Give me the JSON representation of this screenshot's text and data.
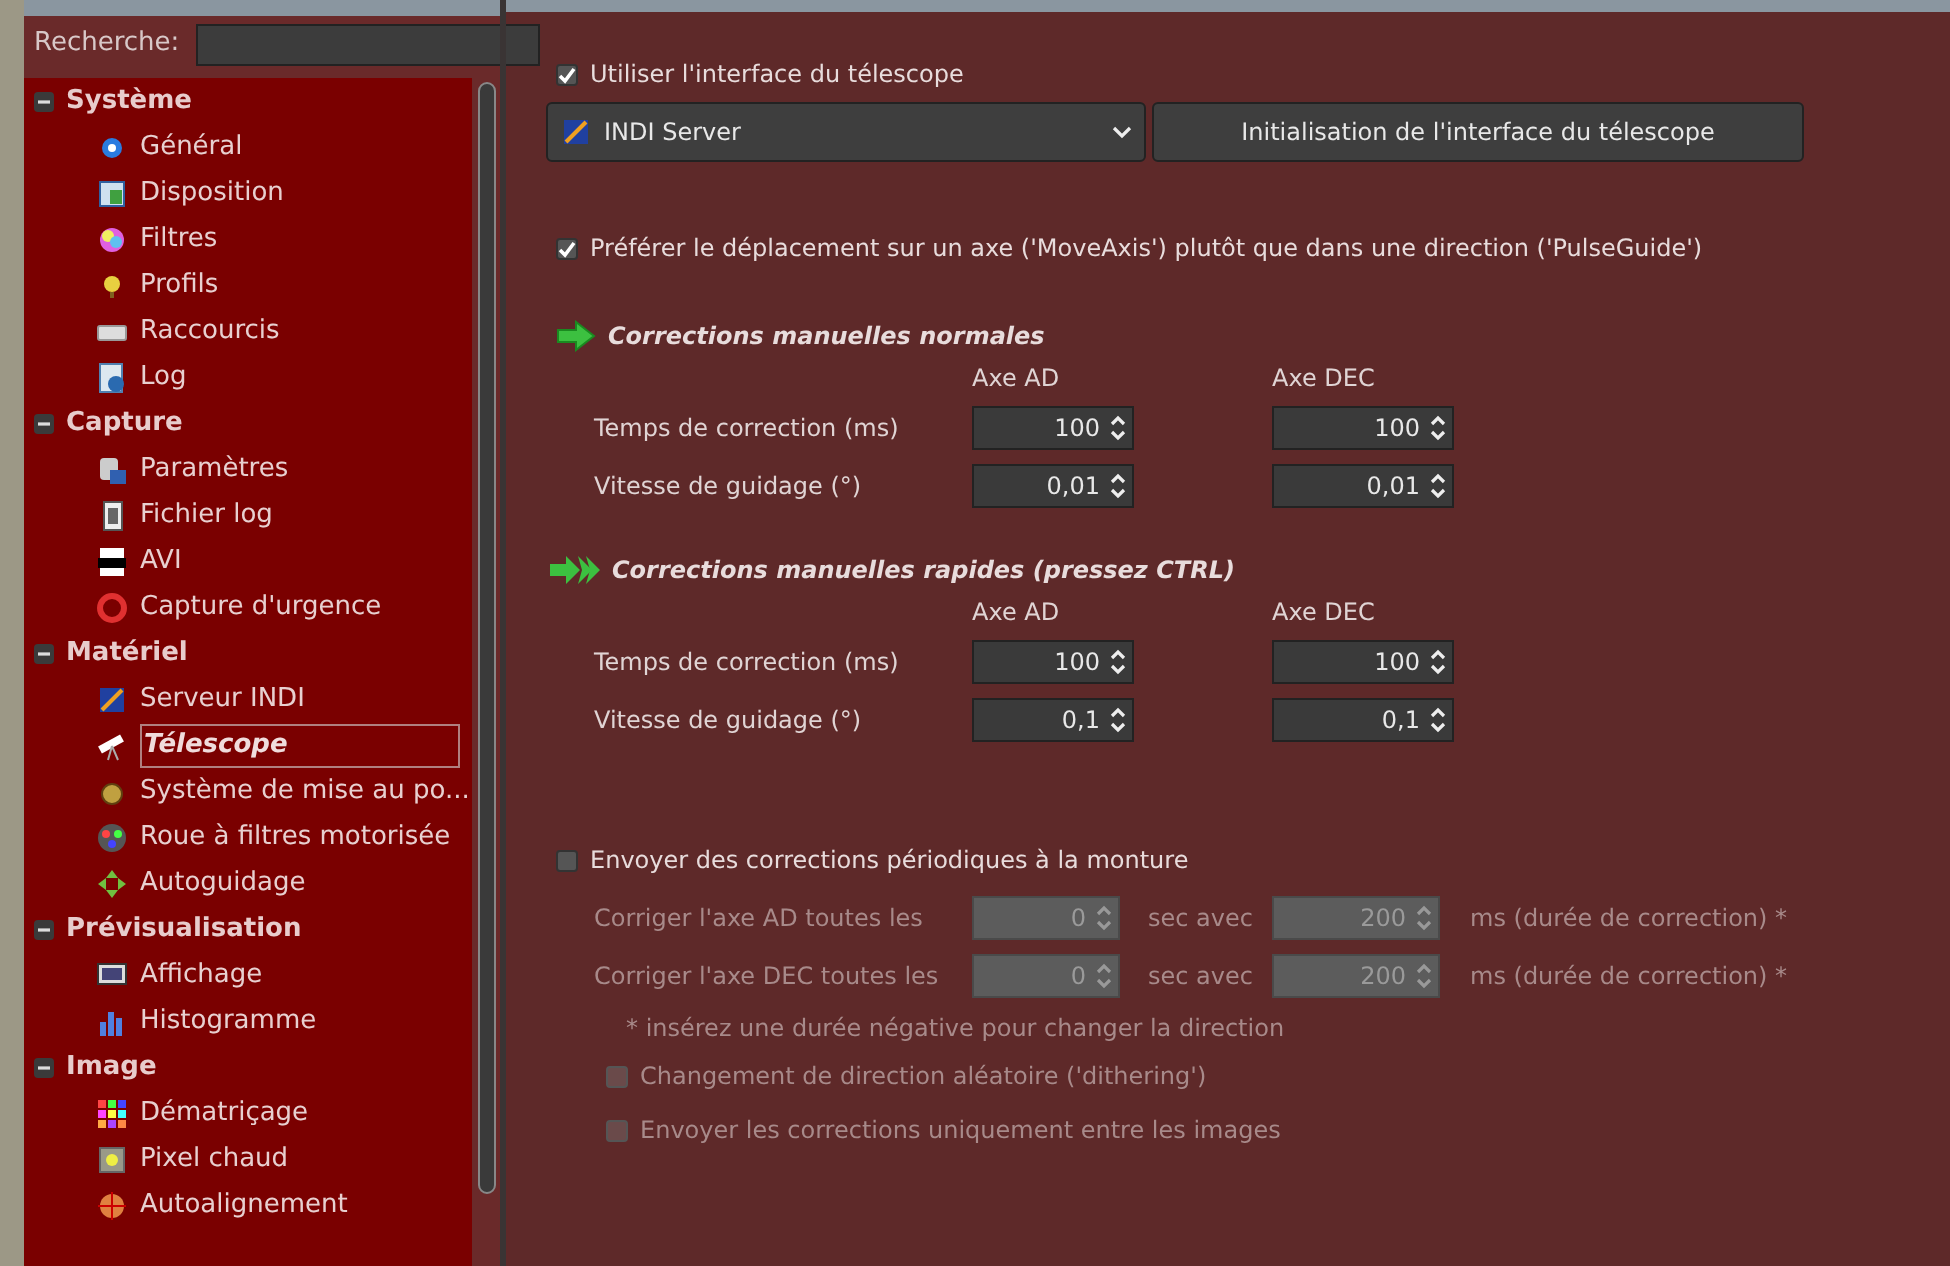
{
  "search": {
    "label": "Recherche:"
  },
  "sidebar": {
    "groups": [
      {
        "label": "Système",
        "expanded": true,
        "items": [
          {
            "label": "Général",
            "selected": false
          },
          {
            "label": "Disposition",
            "selected": false
          },
          {
            "label": "Filtres",
            "selected": false
          },
          {
            "label": "Profils",
            "selected": false
          },
          {
            "label": "Raccourcis",
            "selected": false
          },
          {
            "label": "Log",
            "selected": false
          }
        ]
      },
      {
        "label": "Capture",
        "expanded": true,
        "items": [
          {
            "label": "Paramètres",
            "selected": false
          },
          {
            "label": "Fichier log",
            "selected": false
          },
          {
            "label": "AVI",
            "selected": false
          },
          {
            "label": "Capture d'urgence",
            "selected": false
          }
        ]
      },
      {
        "label": "Matériel",
        "expanded": true,
        "items": [
          {
            "label": "Serveur INDI",
            "selected": false
          },
          {
            "label": "Télescope",
            "selected": true
          },
          {
            "label": "Système de mise au po...",
            "selected": false
          },
          {
            "label": "Roue à filtres motorisée",
            "selected": false
          },
          {
            "label": "Autoguidage",
            "selected": false
          }
        ]
      },
      {
        "label": "Prévisualisation",
        "expanded": true,
        "items": [
          {
            "label": "Affichage",
            "selected": false
          },
          {
            "label": "Histogramme",
            "selected": false
          }
        ]
      },
      {
        "label": "Image",
        "expanded": true,
        "items": [
          {
            "label": "Dématriçage",
            "selected": false
          },
          {
            "label": "Pixel chaud",
            "selected": false
          },
          {
            "label": "Autoalignement",
            "selected": false
          }
        ]
      }
    ]
  },
  "telescope_interface": {
    "label": "Utiliser l'interface du télescope",
    "checked": true
  },
  "driver_select": {
    "value": "INDI Server"
  },
  "init_button": "Initialisation de l'interface du télescope",
  "move_axis": {
    "label": "Préférer le déplacement sur un axe ('MoveAxis') plutôt que dans une direction ('PulseGuide')",
    "checked": true
  },
  "sections": [
    {
      "title": "Corrections manuelles normales",
      "kind": "normal",
      "columns": [
        "Axe AD",
        "Axe DEC"
      ],
      "rows": [
        {
          "label": "Temps de correction (ms)",
          "values": [
            "100",
            "100"
          ]
        },
        {
          "label": "Vitesse de guidage (°)",
          "values": [
            "0,01",
            "0,01"
          ]
        }
      ]
    },
    {
      "title": "Corrections manuelles rapides (pressez CTRL)",
      "kind": "fast",
      "columns": [
        "Axe AD",
        "Axe DEC"
      ],
      "rows": [
        {
          "label": "Temps de correction (ms)",
          "values": [
            "100",
            "100"
          ]
        },
        {
          "label": "Vitesse de guidage (°)",
          "values": [
            "0,1",
            "0,1"
          ]
        }
      ]
    }
  ],
  "periodic": {
    "label": "Envoyer des corrections périodiques à la monture",
    "checked": false,
    "rows": [
      {
        "label": "Corriger l'axe AD toutes les",
        "interval": "0",
        "unit": "sec avec",
        "duration": "200",
        "suffix": "ms (durée de correction) *"
      },
      {
        "label": "Corriger l'axe DEC toutes les",
        "interval": "0",
        "unit": "sec avec",
        "duration": "200",
        "suffix": "ms (durée de correction) *"
      }
    ],
    "note": "* insérez une durée négative pour changer la direction",
    "options": [
      {
        "label": "Changement de direction aléatoire ('dithering')",
        "checked": false
      },
      {
        "label": "Envoyer les corrections uniquement entre les images",
        "checked": false
      }
    ]
  }
}
